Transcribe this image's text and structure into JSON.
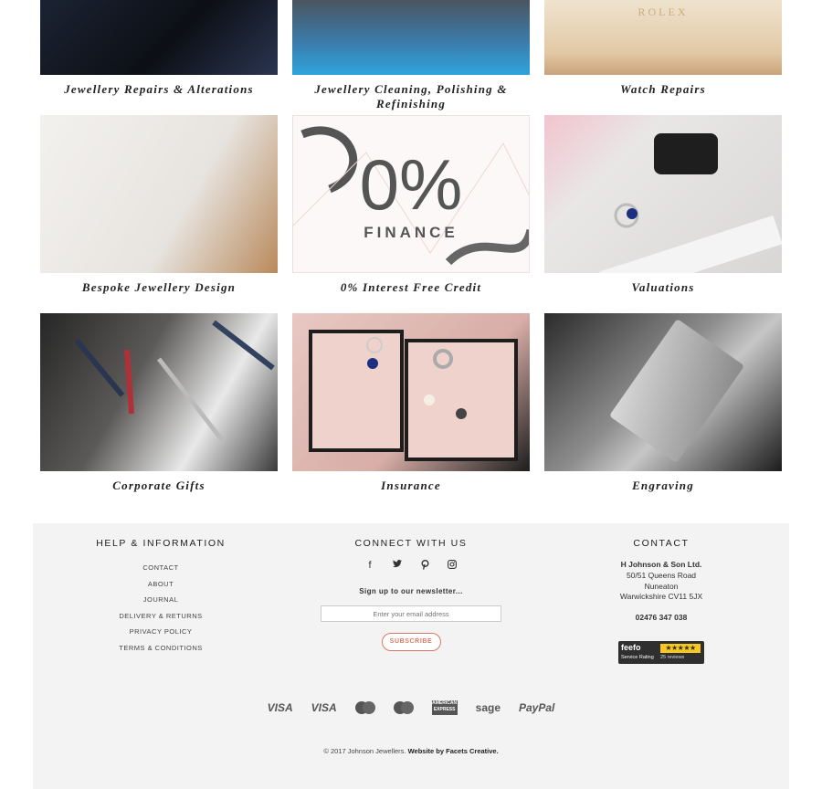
{
  "services": [
    {
      "caption": "Jewellery Repairs & Alterations",
      "image": "jewellery-repair-photo"
    },
    {
      "caption": "Jewellery Cleaning, Polishing & Refinishing",
      "image": "polishing-tools-photo"
    },
    {
      "caption": "Watch Repairs",
      "image": "rolex-box-photo",
      "brand": "ROLEX"
    },
    {
      "caption": "Bespoke Jewellery Design",
      "image": "design-sketch-photo"
    },
    {
      "caption": "0% Interest Free Credit",
      "image": "finance-graphic",
      "percent": "0%",
      "word": "FINANCE"
    },
    {
      "caption": "Valuations",
      "image": "ring-loupe-photo"
    },
    {
      "caption": "Corporate Gifts",
      "image": "pens-photo"
    },
    {
      "caption": "Insurance",
      "image": "jewellery-box-photo"
    },
    {
      "caption": "Engraving",
      "image": "engraved-tag-photo"
    }
  ],
  "footer": {
    "help": {
      "title": "HELP & INFORMATION",
      "links": [
        "CONTACT",
        "ABOUT",
        "JOURNAL",
        "DELIVERY & RETURNS",
        "PRIVACY POLICY",
        "TERMS & CONDITIONS"
      ]
    },
    "connect": {
      "title": "CONNECT WITH US",
      "social_icons": [
        "facebook-icon",
        "twitter-icon",
        "pinterest-icon",
        "instagram-icon"
      ],
      "newsletter": "Sign up to our newsletter...",
      "email_placeholder": "Enter your email address",
      "subscribe_label": "SUBSCRIBE"
    },
    "contact": {
      "title": "CONTACT",
      "company": "H Johnson & Son Ltd.",
      "address": [
        "50/51 Queens Road",
        "Nuneaton",
        "Warwickshire CV11 5JX"
      ],
      "phone": "02476 347 038"
    },
    "feefo": {
      "logo": "feefo",
      "rating_label": "Service Rating",
      "reviews": "25 reviews",
      "stars": 5
    },
    "payments": [
      "VISA",
      "VISA",
      "mastercard",
      "maestro",
      "AMERICAN EXPRESS",
      "sage",
      "PayPal"
    ],
    "copyright": "© 2017 Johnson Jewellers.",
    "credit": "Website by Facets Creative."
  }
}
